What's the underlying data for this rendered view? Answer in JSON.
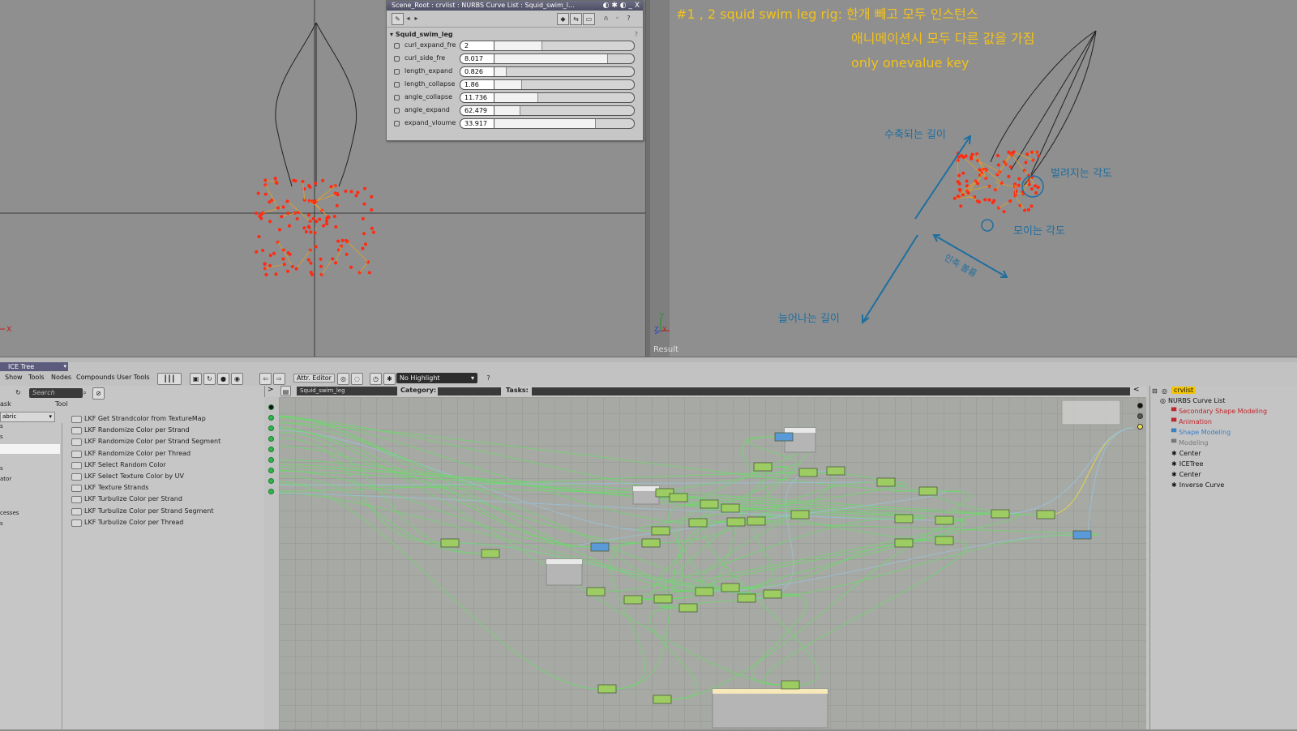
{
  "viewport_left": {
    "axis_x_label": "X"
  },
  "viewport_right": {
    "annotation_line1": "#1 , 2 squid swim leg rig: 한개 빼고 모두 인스턴스",
    "annotation_line2": "애니메이션시 모두 다른 값을 가짐",
    "annotation_line3": "only onevalue key",
    "label_contract_length": "수축되는 길이",
    "label_spread_angle": "벌려지는 각도",
    "label_gather_angle": "모이는 각도",
    "label_swim_volume": "인축 볼륨",
    "label_extend_length": "늘어나는 길이",
    "axis_y_label": "Y",
    "axis_z_label": "Z",
    "axis_x_label": "X",
    "result_label": "Result",
    "accent_color": "#f2c21b",
    "label_color": "#1e6fa0"
  },
  "property_panel": {
    "title": "Scene_Root : crvlist : NURBS Curve List : Squid_swim_l...",
    "title_buttons": "◐ ✱ ◐ _ X",
    "group_name": "Squid_swim_leg",
    "help": "?",
    "params": [
      {
        "label": "curl_expand_fre",
        "value": "2",
        "fill": 0.34
      },
      {
        "label": "curl_side_fre",
        "value": "8.017",
        "fill": 0.81
      },
      {
        "label": "length_expand",
        "value": "0.826",
        "fill": 0.08
      },
      {
        "label": "length_collapse",
        "value": "1.86",
        "fill": 0.19
      },
      {
        "label": "angle_collapse",
        "value": "11.736",
        "fill": 0.31
      },
      {
        "label": "angle_expand",
        "value": "62.479",
        "fill": 0.18
      },
      {
        "label": "expand_vloume",
        "value": "33.917",
        "fill": 0.72
      }
    ]
  },
  "ice_tree": {
    "title": "ICE Tree",
    "menu": [
      "Show",
      "Tools",
      "Nodes",
      "Compounds",
      "User Tools"
    ],
    "attr_editor": "Attr. Editor",
    "highlight": "No Highlight",
    "help": "?",
    "search_placeholder": "Search",
    "tabs": [
      "ask",
      "Tool"
    ],
    "category_select": "abric",
    "categories": [
      "s",
      "s",
      "",
      "s",
      "ator",
      "",
      "cesses",
      "s"
    ],
    "compounds": [
      "LKF Get Strandcolor from TextureMap",
      "LKF Randomize Color per Strand",
      "LKF Randomize Color per Strand Segment",
      "LKF Randomize Color per Thread",
      "LKF Select Random Color",
      "LKF Select Texture Color by UV",
      "LKF Texture Strands",
      "LKF Turbulize Color per Strand",
      "LKF Turbulize Color per Strand Segment",
      "LKF Turbulize Color per Thread"
    ],
    "tree_name": "Squid_swim_leg",
    "category_label": "Category:",
    "tasks_label": "Tasks:"
  },
  "explorer": {
    "root": "crvlist",
    "items": [
      {
        "label": "NURBS Curve List",
        "color": "#111111"
      },
      {
        "label": "Secondary Shape Modeling",
        "color": "#c0262c"
      },
      {
        "label": "Animation",
        "color": "#c0262c"
      },
      {
        "label": "Shape Modeling",
        "color": "#3b7fc4"
      },
      {
        "label": "Modeling",
        "color": "#777777"
      },
      {
        "label": "Center",
        "color": "#111111"
      },
      {
        "label": "ICETree",
        "color": "#111111"
      },
      {
        "label": "Center",
        "color": "#111111"
      },
      {
        "label": "Inverse Curve",
        "color": "#111111"
      }
    ]
  }
}
